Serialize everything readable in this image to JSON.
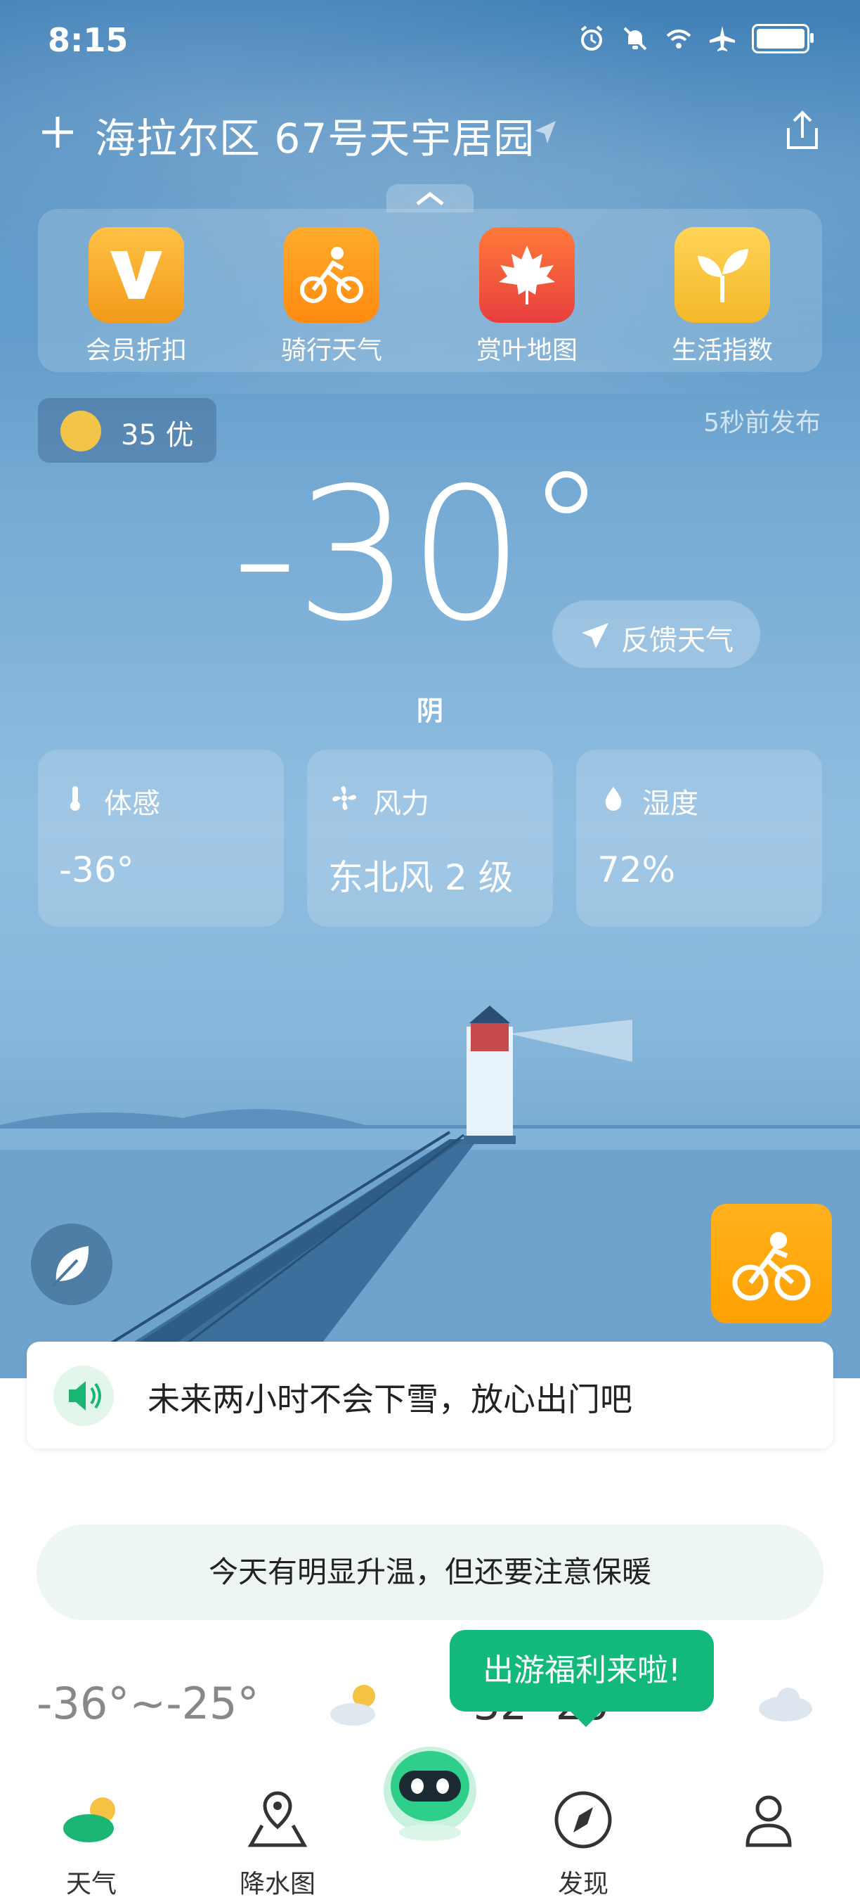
{
  "status_bar": {
    "time": "8:15"
  },
  "header": {
    "location": "海拉尔区 67号天宇居园"
  },
  "quick_actions": [
    {
      "label": "会员折扣",
      "icon": "vip-v-icon",
      "color": "#f6a52a"
    },
    {
      "label": "骑行天气",
      "icon": "cycling-icon",
      "color": "#ff9c1a"
    },
    {
      "label": "赏叶地图",
      "icon": "maple-leaf-icon",
      "color": "#f35b3d"
    },
    {
      "label": "生活指数",
      "icon": "sprout-icon",
      "color": "#f7c437"
    }
  ],
  "aqi": {
    "label": "35 优"
  },
  "publish_time": "5秒前发布",
  "current": {
    "temperature": "-30",
    "condition": "阴",
    "feedback_label": "反馈天气"
  },
  "details": [
    {
      "label": "体感",
      "value": "-36°",
      "icon": "thermometer-icon"
    },
    {
      "label": "风力",
      "value": "东北风 2 级",
      "icon": "fan-icon"
    },
    {
      "label": "湿度",
      "value": "72%",
      "icon": "droplet-icon"
    }
  ],
  "notice": {
    "text": "未来两小时不会下雪，放心出门吧"
  },
  "tip": {
    "text": "今天有明显升温，但还要注意保暖"
  },
  "forecast": {
    "today_range": "-36°~-25°",
    "tomorrow_partial": "-32  -20"
  },
  "promo": {
    "text": "出游福利来啦!"
  },
  "nav": [
    {
      "label": "天气",
      "icon": "weather-icon"
    },
    {
      "label": "降水图",
      "icon": "map-pin-icon"
    },
    {
      "label": "发现",
      "icon": "compass-icon"
    },
    {
      "label": "",
      "icon": "user-icon"
    }
  ],
  "colors": {
    "brand_green": "#13b97a",
    "sky_blue": "#5b97c7"
  }
}
